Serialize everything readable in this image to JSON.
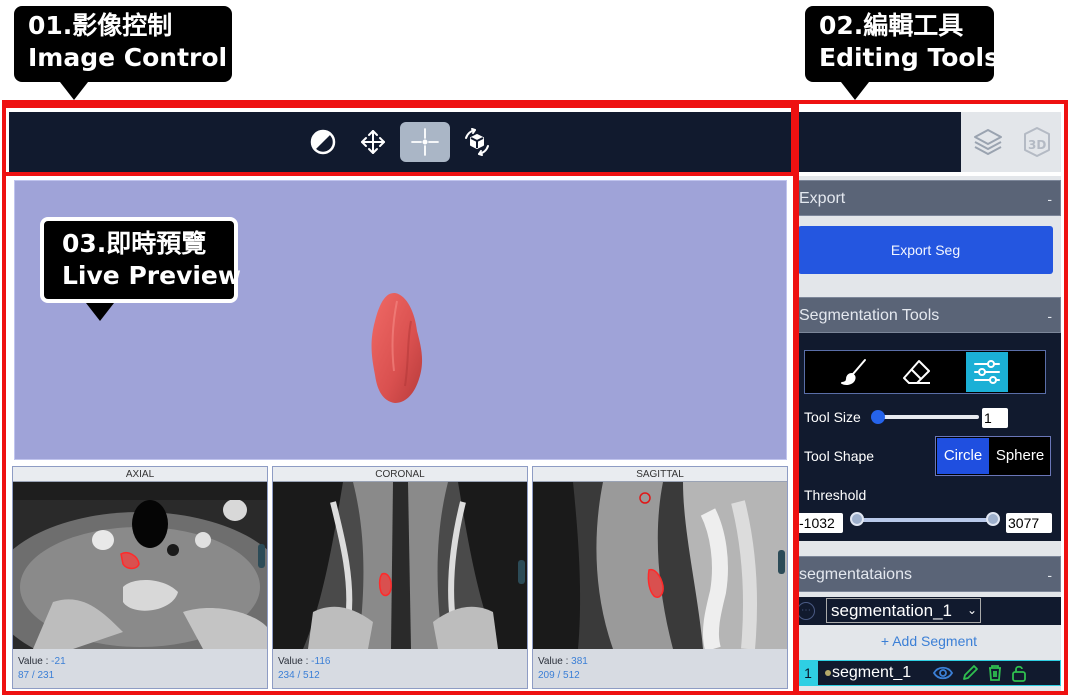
{
  "callouts": {
    "image_control": {
      "line1": "01.影像控制",
      "line2": "Image Control"
    },
    "editing_tools": {
      "line1": "02.編輯工具",
      "line2": "Editing Tools"
    },
    "live_preview": {
      "line1": "03.即時預覽",
      "line2": "Live Preview"
    }
  },
  "toolbar": {
    "tools": [
      {
        "icon": "contrast-icon",
        "active": false
      },
      {
        "icon": "pan-move-icon",
        "active": false
      },
      {
        "icon": "crosshair-icon",
        "active": true
      },
      {
        "icon": "rotate-3d-icon",
        "active": false
      }
    ],
    "edit_tabs": [
      {
        "icon": "layers-icon",
        "active": true
      },
      {
        "icon": "3d-view-icon",
        "label": "3D",
        "active": false
      }
    ]
  },
  "viewports": [
    {
      "title": "AXIAL",
      "value_label": "Value :",
      "value": "-21",
      "slice": "87 / 231"
    },
    {
      "title": "CORONAL",
      "value_label": "Value :",
      "value": "-116",
      "slice": "234 / 512"
    },
    {
      "title": "SAGITTAL",
      "value_label": "Value :",
      "value": "381",
      "slice": "209 / 512"
    }
  ],
  "right_panel": {
    "export": {
      "title": "Export",
      "collapse": "-",
      "button": "Export Seg"
    },
    "segmentation_tools": {
      "title": "Segmentation Tools",
      "collapse": "-",
      "tools": [
        {
          "icon": "brush-icon",
          "active": false
        },
        {
          "icon": "eraser-icon",
          "active": false
        },
        {
          "icon": "threshold-settings-icon",
          "active": true
        }
      ],
      "tool_size_label": "Tool Size",
      "tool_size_value": "1",
      "tool_size_fraction": 0.0,
      "tool_shape_label": "Tool Shape",
      "shape_circle": "Circle",
      "shape_sphere": "Sphere",
      "threshold_label": "Threshold",
      "threshold_min": "-1032",
      "threshold_max": "3077"
    },
    "segmentations": {
      "title": "segmentataions",
      "collapse": "-",
      "selected": "segmentation_1",
      "add_label": "+ Add Segment",
      "items": [
        {
          "index": "1",
          "name": "segment_1"
        }
      ]
    }
  },
  "colors": {
    "toolbar_bg": "#111a2e",
    "preview_bg": "#9fa3d8",
    "accent_blue": "#2456e0",
    "accent_cyan": "#1bb0d6",
    "segment_red": "#e0504f",
    "highlight_red": "#ee1111"
  }
}
